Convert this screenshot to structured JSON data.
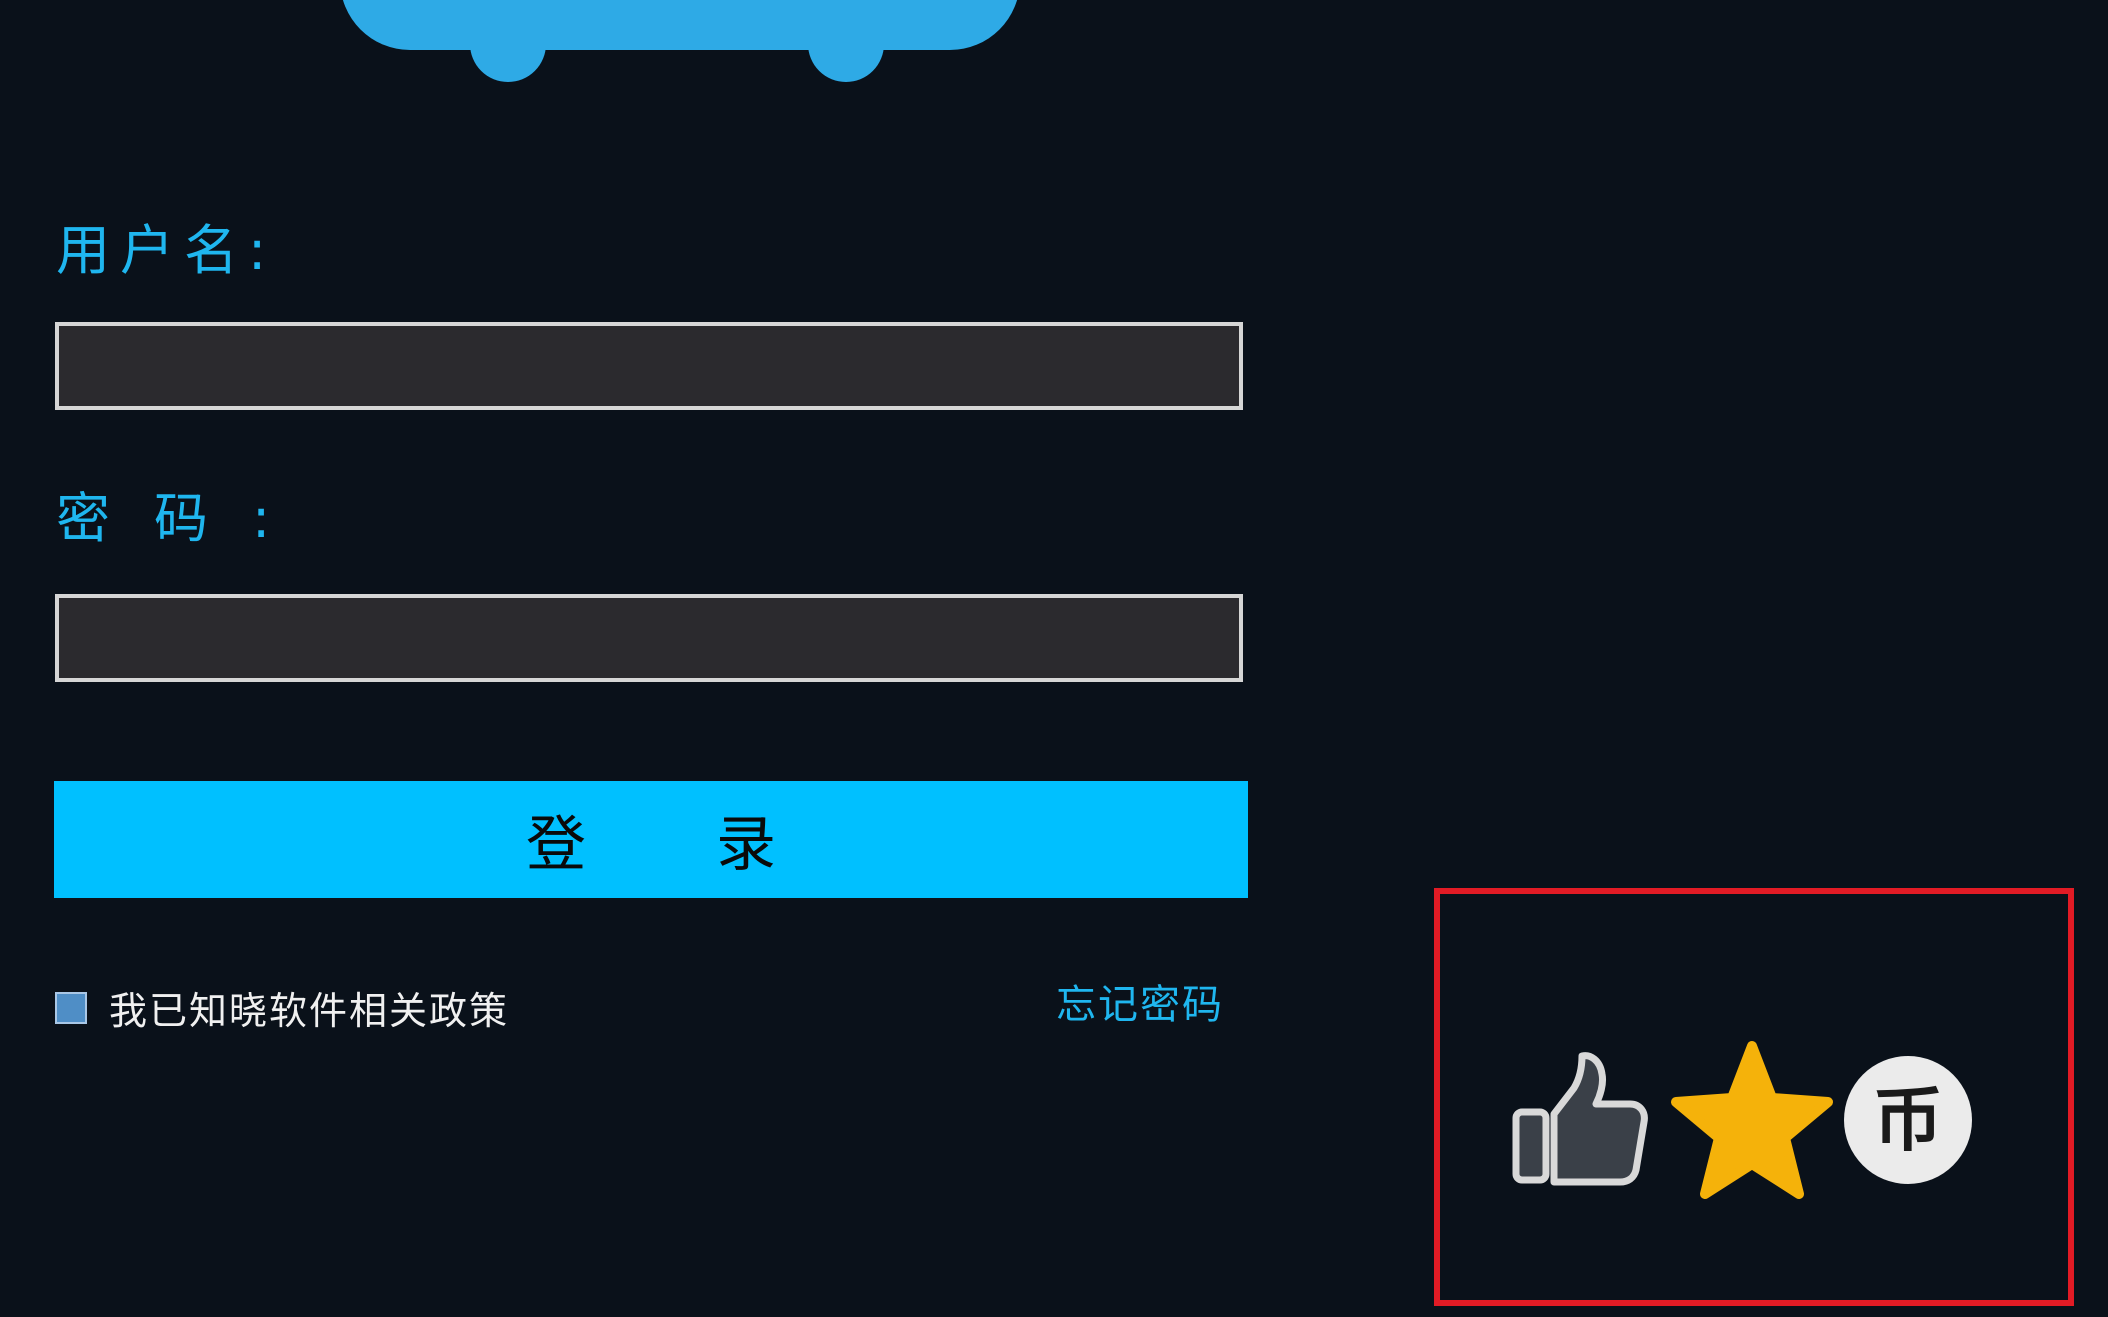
{
  "login_form": {
    "username_label": "用户名:",
    "password_label": "密码:",
    "username_value": "",
    "password_value": "",
    "login_button_label": "登录",
    "agree_text": "我已知晓软件相关政策",
    "agree_checked": false,
    "forgot_password_label": "忘记密码"
  },
  "actions": {
    "icons": [
      "thumbs-up-icon",
      "star-icon",
      "coin-icon"
    ],
    "coin_glyph": "币"
  },
  "colors": {
    "background": "#0a111a",
    "accent": "#00c0ff",
    "label": "#1fb6ef",
    "star": "#f5b20a",
    "highlight": "#e21b25"
  }
}
